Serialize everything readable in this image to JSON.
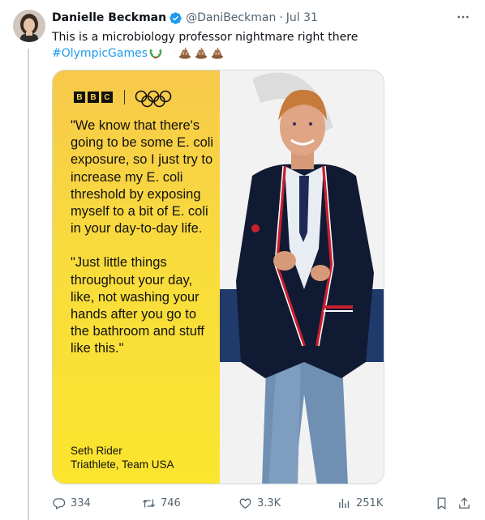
{
  "tweet": {
    "author_name": "Danielle Beckman",
    "handle": "@DaniBeckman",
    "separator": "·",
    "time": "Jul 31",
    "text": "This is a microbiology professor nightmare right there",
    "hashtag": "#OlympicGames",
    "emoji_icons": [
      "laurel-wreath-icon",
      "poop-icon",
      "poop-icon",
      "poop-icon"
    ]
  },
  "media": {
    "brand": [
      "B",
      "B",
      "C"
    ],
    "quote_1": "\"We know that there's going to be some E. coli exposure, so I just try to increase my E. coli threshold by exposing myself to a bit of E. coli in your day-to-day life.",
    "quote_2": "\"Just little things throughout your day, like, not washing your hands after you go to the bathroom and stuff like this.\"",
    "attribution_name": "Seth Rider",
    "attribution_role": "Triathlete, Team USA"
  },
  "actions": {
    "replies": "334",
    "reposts": "746",
    "likes": "3.3K",
    "views": "251K"
  },
  "colors": {
    "accent": "#1d9bf0",
    "muted": "#536471",
    "card_yellow": "#f9dc3c"
  }
}
